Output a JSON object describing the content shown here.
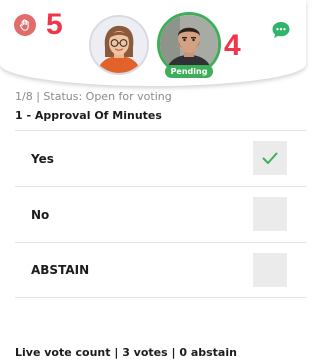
{
  "header": {
    "raise_hand_icon": "hand-icon",
    "raise_hand_color": "#e06c6c",
    "left_count": "5",
    "right_count": "4",
    "count_color": "#f0344a",
    "avatar_1": {
      "icon": "avatar-woman-glasses"
    },
    "avatar_2": {
      "icon": "avatar-bearded-man",
      "badge": "Pending",
      "badge_color": "#3fae5a"
    },
    "chat_icon": "chat-bubble-icon",
    "chat_color": "#2fb56a"
  },
  "vote": {
    "status_line": "1/8 | Status: Open for voting",
    "question": "1 - Approval Of Minutes",
    "options": [
      {
        "label": "Yes",
        "selected": true
      },
      {
        "label": "No",
        "selected": false
      },
      {
        "label": "ABSTAIN",
        "selected": false
      }
    ],
    "check_color": "#3fae5a",
    "live_count": "Live vote count | 3 votes | 0 abstain"
  }
}
